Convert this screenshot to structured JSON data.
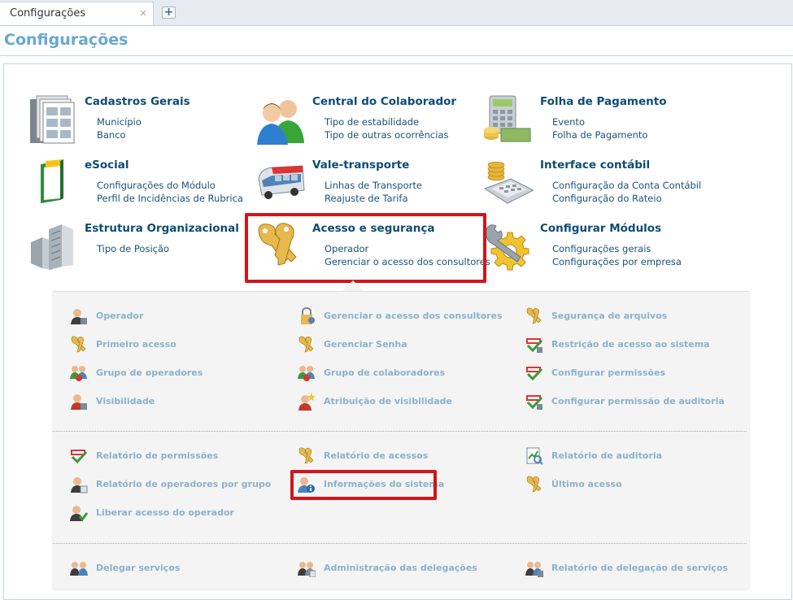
{
  "tabs": {
    "active_label": "Configurações",
    "close_glyph": "×",
    "add_glyph": "+"
  },
  "page": {
    "title": "Configurações"
  },
  "tiles": [
    {
      "title": "Cadastros Gerais",
      "icon": "documents-icon",
      "links": [
        "Município",
        "Banco"
      ]
    },
    {
      "title": "Central do Colaborador",
      "icon": "people-icon",
      "links": [
        "Tipo de estabilidade",
        "Tipo de outras ocorrências"
      ]
    },
    {
      "title": "Folha de Pagamento",
      "icon": "calculator-money-icon",
      "links": [
        "Evento",
        "Folha de Pagamento"
      ]
    },
    {
      "title": "eSocial",
      "icon": "esocial-icon",
      "links": [
        "Configurações do Módulo",
        "Perfil de Incidências de Rubrica"
      ]
    },
    {
      "title": "Vale-transporte",
      "icon": "bus-icon",
      "links": [
        "Linhas de Transporte",
        "Reajuste de Tarifa"
      ]
    },
    {
      "title": "Interface contábil",
      "icon": "accounting-calculator-icon",
      "links": [
        "Configuração da Conta Contábil",
        "Configuração do Rateio"
      ]
    },
    {
      "title": "Estrutura Organizacional",
      "icon": "buildings-icon",
      "links": [
        "Tipo de Posição"
      ]
    },
    {
      "title": "Acesso e segurança",
      "icon": "keys-icon",
      "links": [
        "Operador",
        "Gerenciar o acesso dos consultores"
      ]
    },
    {
      "title": "Configurar Módulos",
      "icon": "wrench-gear-icon",
      "links": [
        "Configurações gerais",
        "Configurações por empresa"
      ]
    }
  ],
  "submenu": {
    "section1": [
      {
        "label": "Operador",
        "icon": "operator-icon"
      },
      {
        "label": "Gerenciar o acesso dos consultores",
        "icon": "lock-user-icon"
      },
      {
        "label": "Segurança de arquivos",
        "icon": "keys-icon"
      },
      {
        "label": "Primeiro acesso",
        "icon": "keys-icon"
      },
      {
        "label": "Gerenciar Senha",
        "icon": "keys-icon"
      },
      {
        "label": "Restrição de acesso ao sistema",
        "icon": "checklist-icon"
      },
      {
        "label": "Grupo de operadores",
        "icon": "group-icon"
      },
      {
        "label": "Grupo de colaboradores",
        "icon": "group-icon"
      },
      {
        "label": "Configurar permissões",
        "icon": "checklist-icon"
      },
      {
        "label": "Visibilidade",
        "icon": "user-red-icon"
      },
      {
        "label": "Atribuição de visibilidade",
        "icon": "user-star-icon"
      },
      {
        "label": "Configurar permissão de auditoria",
        "icon": "checklist-icon"
      }
    ],
    "section2": [
      {
        "label": "Relatório de permissões",
        "icon": "checklist-icon"
      },
      {
        "label": "Relatório de acessos",
        "icon": "keys-icon"
      },
      {
        "label": "Relatório de auditoria",
        "icon": "audit-report-icon"
      },
      {
        "label": "Relatório de operadores por grupo",
        "icon": "operator-icon"
      },
      {
        "label": "Informações do sistema",
        "icon": "user-info-icon"
      },
      {
        "label": "Último acesso",
        "icon": "keys-icon"
      },
      {
        "label": "Liberar acesso do operador",
        "icon": "user-check-icon"
      }
    ],
    "section3": [
      {
        "label": "Delegar serviços",
        "icon": "delegate-icon"
      },
      {
        "label": "Administração das delegações",
        "icon": "delegate-admin-icon"
      },
      {
        "label": "Relatório de delegação de serviços",
        "icon": "delegate-report-icon"
      }
    ]
  },
  "colors": {
    "title": "#67a8d2",
    "tile_title": "#0e4c73",
    "tile_link": "#1b527a",
    "submenu_link": "#8bb2cc",
    "highlight": "#d3141b"
  }
}
